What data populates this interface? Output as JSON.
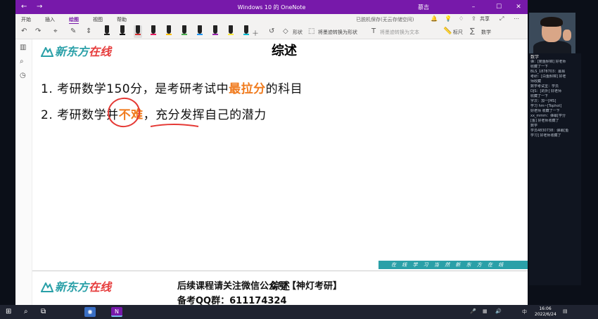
{
  "window": {
    "title": "Windows 10 的 OneNote",
    "user": "慕吉",
    "back": "←",
    "forward": "→",
    "minimize": "–",
    "maximize": "☐",
    "close": "✕"
  },
  "menu": {
    "tabs": [
      "开始",
      "插入",
      "绘图",
      "视图",
      "帮助"
    ],
    "active_tab": "绘图",
    "status": "已脱机保存(无云存储空间)",
    "share": "共享"
  },
  "toolbar": {
    "shapes_label": "形状",
    "ink_to_shape": "将墨迹转换为形状",
    "ink_to_text": "将墨迹转换为文本",
    "ruler": "标尺",
    "math": "数学",
    "pens": [
      {
        "color": "#222222"
      },
      {
        "color": "#111111"
      },
      {
        "color": "#d32f2f"
      },
      {
        "color": "#e91e63"
      },
      {
        "color": "#ffc107"
      },
      {
        "color": "#4caf50"
      },
      {
        "color": "#2196f3"
      },
      {
        "color": "#9c27b0"
      },
      {
        "color": "#ffeb3b"
      },
      {
        "color": "#00bcd4"
      }
    ]
  },
  "page": {
    "brand": "新东方在线",
    "brand_prefix": "新东方",
    "brand_suffix": "在线",
    "title": "综述",
    "line1_prefix": "1. 考研数学150分，是考研考试中",
    "line1_highlight": "最拉分",
    "line1_suffix": "的科目",
    "line2_prefix": "2. 考研数学并",
    "line2_highlight": "不难",
    "line2_suffix": "，充分发挥自己的潜力",
    "footer_band": "在 线 学 习   当 然 新 东 方 在 线",
    "footer_line1": "后续课程请关注微信公众号【神灯考研】",
    "footer_line2": "备考QQ群：611174324",
    "footer_overlay": "综述"
  },
  "chat": {
    "header": "数学",
    "messages": [
      "弹：[鲍鱼斛锦] 好老师",
      "收藏了一下",
      "BLS_1878703：最易",
      "考研：[白鱼斛锦] 好老",
      "师收藏",
      "数学考试里：学员",
      "DJS：[的外] 好老师",
      "收藏了一下",
      "字次：加一[MS]",
      "学习 hm~[Tophot]",
      "好老师 收藏了一下",
      "xx_mmm：弹幕[学分",
      "[鱼] 好老师收藏了",
      "数学",
      "学员4830738：弹幕[鱼",
      "学习] 好老师收藏了"
    ]
  },
  "taskbar": {
    "time": "16:06",
    "date": "2022/6/24",
    "ime": "中",
    "apps": [
      "task-view",
      "onenote-app",
      "teams-app"
    ]
  },
  "colors": {
    "onenote_purple": "#7719aa",
    "brand_teal": "#2aa0a8",
    "highlight_orange": "#f07b1e",
    "ink_red": "#e53935"
  }
}
